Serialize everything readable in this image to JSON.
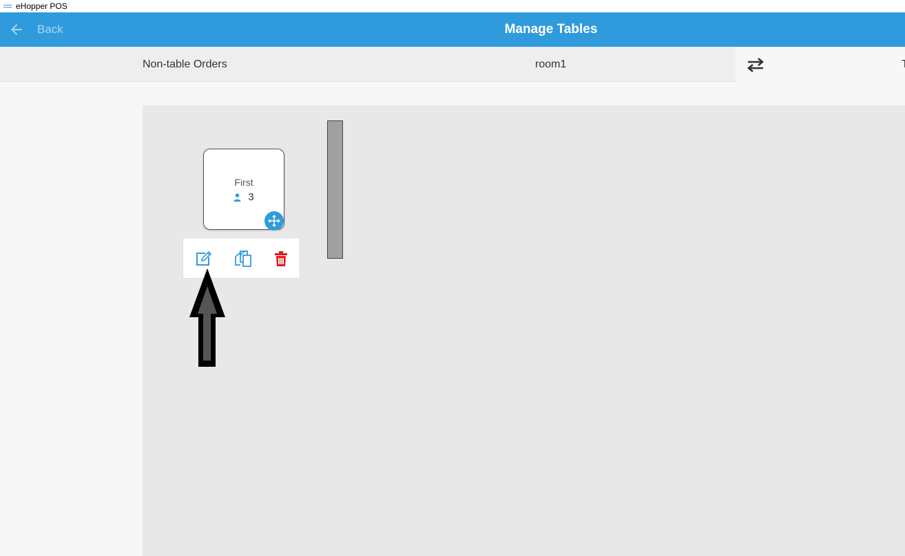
{
  "window": {
    "title": "eHopper POS"
  },
  "header": {
    "back_label": "Back",
    "title": "Manage Tables",
    "color": "#2f9bdc"
  },
  "tabs": {
    "non_table": "Non-table Orders",
    "room": "room1",
    "cut_label": "T"
  },
  "table": {
    "name": "First",
    "seats": "3"
  },
  "icons": {
    "back": "arrow-left-icon",
    "swap": "swap-arrows-icon",
    "person": "person-icon",
    "move": "move-arrows-icon",
    "edit": "edit-pencil-icon",
    "duplicate": "duplicate-icon",
    "delete": "trash-icon"
  },
  "colors": {
    "accent": "#2f9bdc",
    "delete": "#e31b1b",
    "wall": "#a0a0a0"
  }
}
